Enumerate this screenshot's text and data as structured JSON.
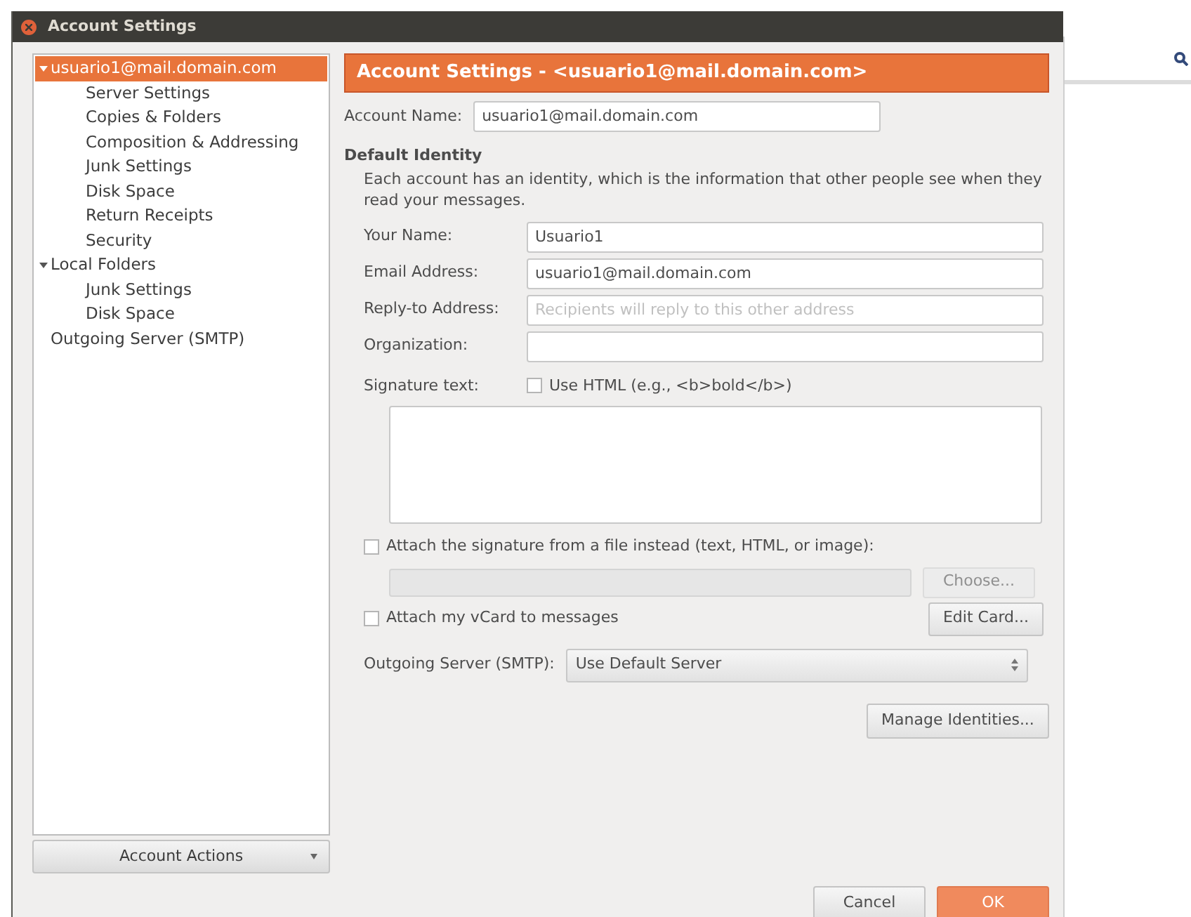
{
  "window": {
    "title": "Account Settings"
  },
  "tree": [
    {
      "label": "usuario1@mail.domain.com",
      "selected": true,
      "expanded": true,
      "children": [
        {
          "label": "Server Settings",
          "selected": false
        },
        {
          "label": "Copies & Folders",
          "selected": false
        },
        {
          "label": "Composition & Addressing",
          "selected": false
        },
        {
          "label": "Junk Settings",
          "selected": false
        },
        {
          "label": "Disk Space",
          "selected": false
        },
        {
          "label": "Return Receipts",
          "selected": false
        },
        {
          "label": "Security",
          "selected": false
        }
      ]
    },
    {
      "label": "Local Folders",
      "selected": false,
      "expanded": true,
      "children": [
        {
          "label": "Junk Settings",
          "selected": false
        },
        {
          "label": "Disk Space",
          "selected": false
        }
      ]
    },
    {
      "label": "Outgoing Server (SMTP)",
      "selected": false
    }
  ],
  "account_actions": "Account Actions",
  "header": "Account Settings - <usuario1@mail.domain.com>",
  "account_name": {
    "label": "Account Name:",
    "value": "usuario1@mail.domain.com"
  },
  "identity": {
    "title": "Default Identity",
    "description": "Each account has an identity, which is the information that other people see when they read your messages.",
    "fields": [
      {
        "label": "Your Name:",
        "value": "Usuario1"
      },
      {
        "label": "Email Address:",
        "value": "usuario1@mail.domain.com"
      },
      {
        "label": "Reply-to Address:",
        "placeholder": "Recipients will reply to this other address"
      },
      {
        "label": "Organization:"
      }
    ]
  },
  "signature": {
    "label": "Signature text:",
    "use_html": {
      "label": "Use HTML (e.g., <b>bold</b>)",
      "checked": false
    }
  },
  "attach_file": {
    "label": "Attach the signature from a file instead (text, HTML, or image):",
    "checked": false,
    "choose": "Choose..."
  },
  "vcard": {
    "label": "Attach my vCard to messages",
    "checked": false,
    "edit": "Edit Card..."
  },
  "smtp": {
    "label": "Outgoing Server (SMTP):",
    "value": "Use Default Server"
  },
  "manage": "Manage Identities...",
  "buttons": [
    {
      "label": "Cancel",
      "kind": "normal"
    },
    {
      "label": "OK",
      "kind": "default"
    }
  ]
}
